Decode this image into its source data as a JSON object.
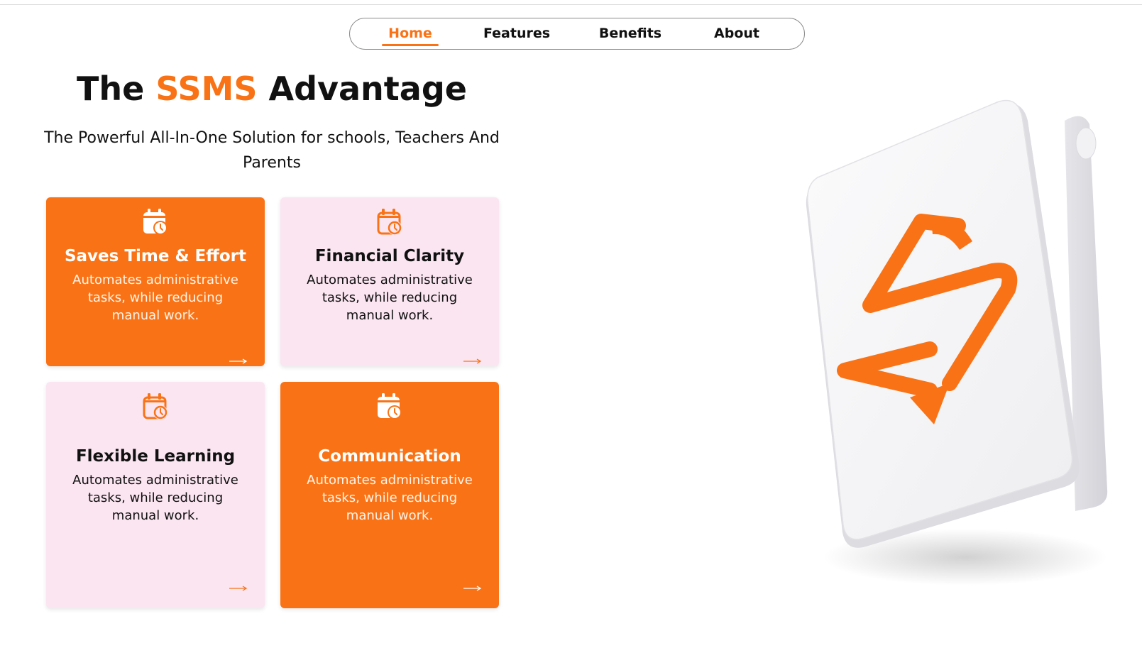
{
  "nav": {
    "items": [
      {
        "label": "Home",
        "active": true
      },
      {
        "label": "Features",
        "active": false
      },
      {
        "label": "Benefits",
        "active": false
      },
      {
        "label": "About",
        "active": false
      }
    ]
  },
  "hero": {
    "title_pre": "The ",
    "title_accent": "SSMS",
    "title_post": " Advantage",
    "subtitle": "The Powerful All-In-One Solution for schools, Teachers And Parents"
  },
  "cards": [
    {
      "title": "Saves Time & Effort",
      "description": "Automates administrative tasks, while reducing manual work.",
      "style": "orange",
      "icon": "calendar-clock-icon"
    },
    {
      "title": "Financial Clarity",
      "description": "Automates administrative tasks, while reducing manual work.",
      "style": "pink",
      "icon": "calendar-clock-icon"
    },
    {
      "title": "Flexible Learning",
      "description": "Automates administrative tasks, while reducing manual work.",
      "style": "pink",
      "icon": "calendar-clock-icon"
    },
    {
      "title": "Communication",
      "description": "Automates administrative tasks, while reducing manual work.",
      "style": "orange",
      "icon": "calendar-clock-icon"
    }
  ],
  "colors": {
    "accent": "#f97316",
    "card_pink": "#fbe5f1",
    "text": "#111111"
  },
  "device": {
    "logo_icon": "ssms-s-logo"
  }
}
